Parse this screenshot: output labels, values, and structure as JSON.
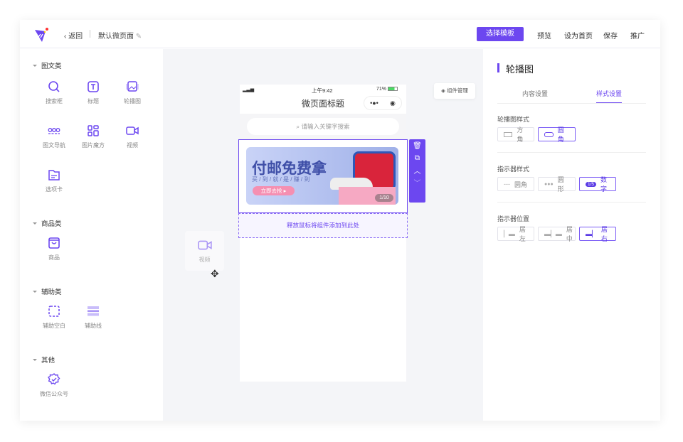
{
  "header": {
    "back": "返回",
    "page_name": "默认微页面",
    "choose_template": "选择模板",
    "actions": [
      "预览",
      "设为首页",
      "保存",
      "推广"
    ]
  },
  "colors": {
    "accent": "#6c47f0",
    "canvas_bg": "#f4f5f8"
  },
  "sidebar": {
    "sections": [
      {
        "title": "图文类",
        "items": [
          {
            "label": "搜索框",
            "icon": "search-icon"
          },
          {
            "label": "标题",
            "icon": "title-icon"
          },
          {
            "label": "轮播图",
            "icon": "carousel-icon"
          },
          {
            "label": "图文导航",
            "icon": "nav-icon"
          },
          {
            "label": "图片魔方",
            "icon": "grid-icon"
          },
          {
            "label": "视频",
            "icon": "video-icon"
          },
          {
            "label": "选项卡",
            "icon": "tab-icon"
          }
        ]
      },
      {
        "title": "商品类",
        "items": [
          {
            "label": "商品",
            "icon": "bag-icon"
          }
        ]
      },
      {
        "title": "辅助类",
        "items": [
          {
            "label": "辅助空白",
            "icon": "blank-icon"
          },
          {
            "label": "辅助线",
            "icon": "line-icon"
          }
        ]
      },
      {
        "title": "其他",
        "items": [
          {
            "label": "微信公众号",
            "icon": "wechat-badge-icon"
          }
        ]
      }
    ]
  },
  "phone": {
    "time": "上午9:42",
    "battery": "71%",
    "title": "微页面标题",
    "search_placeholder": "请输入关键字搜索",
    "banner": {
      "headline": "付邮免费拿",
      "sub": "买 / 到 / 就 / 是 / 赚 / 到",
      "cta": "立即去抢",
      "indicator": "1/10"
    },
    "drop_hint": "释放鼠标将组件添加到此处"
  },
  "drag_item": {
    "label": "视频"
  },
  "component_manager": "组件管理",
  "panel": {
    "title": "轮播图",
    "tabs": [
      "内容设置",
      "样式设置"
    ],
    "active_tab": 1,
    "groups": [
      {
        "label": "轮播图样式",
        "options": [
          "方角",
          "圆角"
        ],
        "selected": 1
      },
      {
        "label": "指示器样式",
        "options": [
          "圆角",
          "圆形",
          "数字"
        ],
        "selected": 2,
        "number_badge": "1/5"
      },
      {
        "label": "指示器位置",
        "options": [
          "居左",
          "居中",
          "居右"
        ],
        "selected": 2
      }
    ]
  }
}
